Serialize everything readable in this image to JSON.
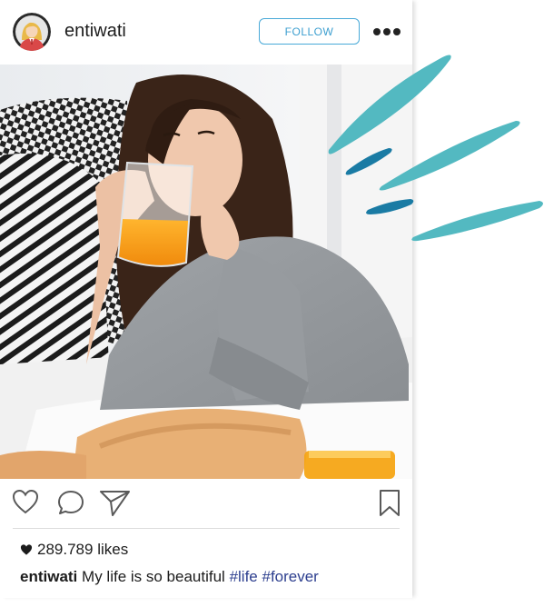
{
  "post": {
    "username": "entiwati",
    "follow_label": "FOLLOW",
    "likes_count": "289.789",
    "likes_suffix": "likes",
    "caption_author": "entiwati",
    "caption_text": "My life is so beautiful",
    "hashtags": [
      "#life",
      "#forever"
    ]
  },
  "icons": {
    "menu": "more-options-icon",
    "like": "heart-outline-icon",
    "comment": "comment-bubble-icon",
    "share": "paper-plane-icon",
    "save": "bookmark-icon",
    "likes_heart": "heart-filled-icon"
  },
  "colors": {
    "accent": "#48a9d8",
    "hashtag": "#2d3f8f",
    "splash_light": "#53b9c1",
    "splash_dark": "#1a7ba4"
  }
}
